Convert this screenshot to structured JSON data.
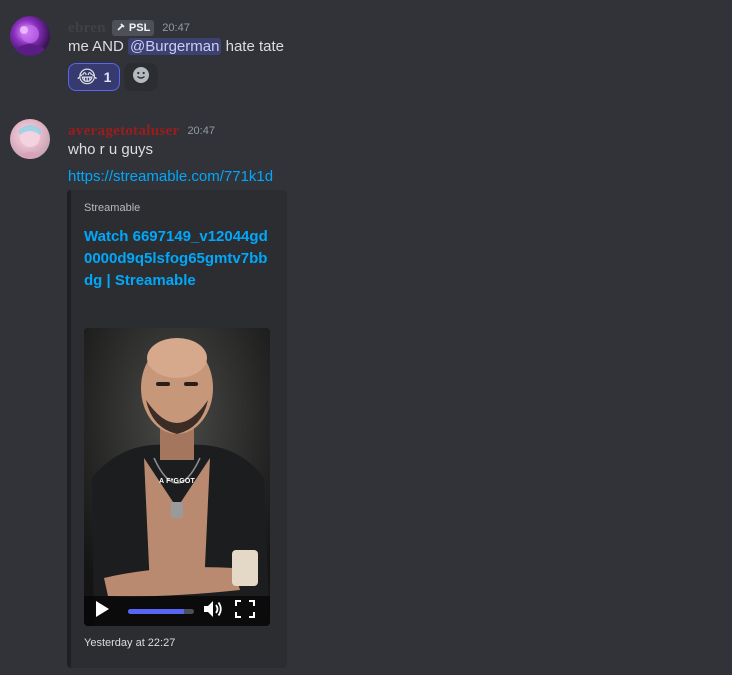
{
  "messages": [
    {
      "author": "ebren",
      "author_color": "#3f4147",
      "tag": "PSL",
      "time": "20:47",
      "text_before": "me AND ",
      "mention": "@Burgerman",
      "text_after": " hate tate",
      "reactions": [
        {
          "emoji_name": "face-with-tears-of-joy",
          "emoji": "😂",
          "count": "1",
          "active": true
        }
      ]
    },
    {
      "author": "averagetotaluser",
      "author_color": "#9b1c1c",
      "time": "20:47",
      "text": "who r u guys",
      "link": "https://streamable.com/771k1d",
      "embed": {
        "provider": "Streamable",
        "title": "Watch 6697149_v12044gd0000d9q5lsfog65gmtv7bbdg | Streamable",
        "caption": "A F*GGOT",
        "progress": 0.85,
        "footer": "Yesterday at 22:27",
        "accent": "#5865f2"
      }
    }
  ],
  "icons": {
    "tag_icon": "wrench-icon",
    "add_reaction": "add-reaction-icon",
    "play": "play-icon",
    "volume": "volume-icon",
    "fullscreen": "fullscreen-icon"
  }
}
